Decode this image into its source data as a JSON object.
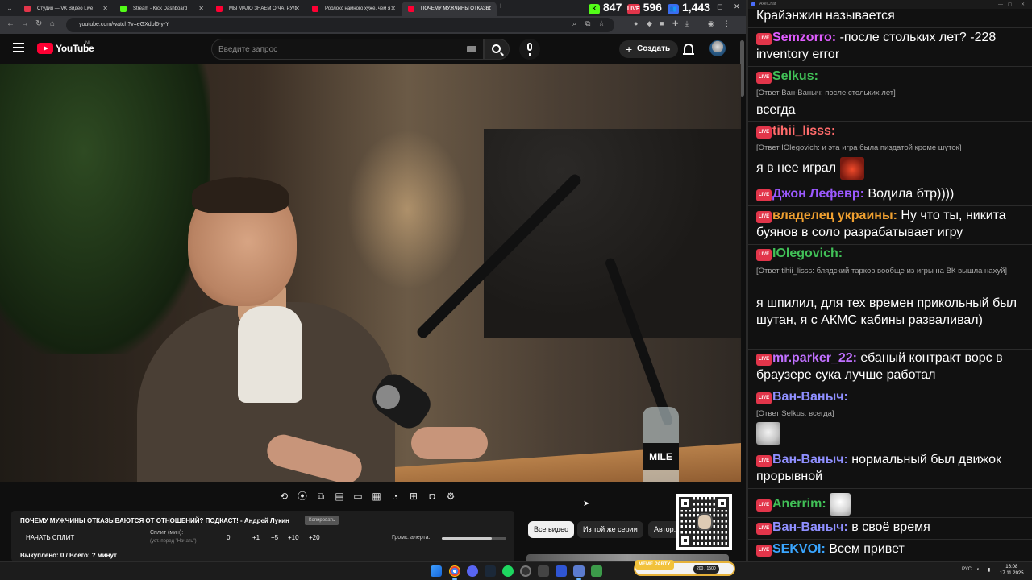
{
  "browser": {
    "tabs": [
      {
        "title": "Студия — VK Видео Live",
        "color": "#e2354a"
      },
      {
        "title": "Stream - Kick Dashboard",
        "color": "#53fc18"
      },
      {
        "title": "МЫ МАЛО ЗНАЕМ О ЧАТРУЛ",
        "color": "#ff0033"
      },
      {
        "title": "Роблокс намного хуже, чем я",
        "color": "#ff0033"
      },
      {
        "title": "ПОЧЕМУ МУЖЧИНЫ ОТКАЗЫ",
        "color": "#ff0033"
      }
    ],
    "url": "youtube.com/watch?v=eGXdpl6-y-Y",
    "counters": {
      "kick": "847",
      "vk": "596",
      "viewers": "1,443"
    },
    "counter_vk_icon": "LIVE"
  },
  "youtube": {
    "logo_text": "YouTube",
    "region": "NL",
    "search_placeholder": "Введите запрос",
    "create_label": "Создать"
  },
  "video": {
    "bottle_text": "MILE"
  },
  "overlay": {
    "title": "ПОЧЕМУ МУЖЧИНЫ ОТКАЗЫВАЮТСЯ ОТ ОТНОШЕНИЙ? ПОДКАСТ! - Андрей Лукин",
    "copy_label": "Копировать",
    "start_split": "НАЧАТЬ СПЛИТ",
    "split_label": "Сплит (мин):",
    "split_hint": "(уст. перед \"Начать\")",
    "split_buttons": [
      "0",
      "+1",
      "+5",
      "+10",
      "+20"
    ],
    "volume_label": "Громк. алерта:",
    "volume_level": 0.78,
    "redeemed": "Выкуплено: 0 / Всего: ? минут"
  },
  "chips": [
    "Все видео",
    "Из той же серии",
    "Автор:"
  ],
  "chat": {
    "window_title": "AxelChat",
    "live_badge": "LIVE",
    "messages": [
      {
        "type": "text",
        "text": "Крайэнжин называется"
      },
      {
        "nick": "Semzorro:",
        "color": "#e05cff",
        "text": " -после стольких лет? -228 inventory error"
      },
      {
        "nick": "Selkus:",
        "color": "#41c057",
        "reply": "[Ответ Ван-Ваныч: после стольких лет]",
        "text": "всегда"
      },
      {
        "nick": "tihii_lisss:",
        "color": "#ff6b6b",
        "reply": "[Ответ IOlegovich: и эта игра была пиздатой кроме шуток]",
        "text": "я в нее играл"
      },
      {
        "nick": "Джон Лефевр:",
        "color": "#9b59ff",
        "text": " Водила бтр))))"
      },
      {
        "nick": "владелец украины:",
        "color": "#f0a030",
        "text": " Ну что ты, никита буянов в соло разрабатывает игру"
      },
      {
        "nick": "IOlegovich:",
        "color": "#41c057",
        "reply": "[Ответ tihii_lisss: блядский тарков вообще из игры на ВК вышла нахуй]",
        "text": "я шпилил, для тех времен прикольный был шутан, я с АКМС кабины разваливал)"
      },
      {
        "nick": "mr.parker_22:",
        "color": "#c070ff",
        "text": " ебаный контракт ворс в браузере сука лучше работал"
      },
      {
        "nick": "Ван-Ваныч:",
        "color": "#8f8fff",
        "reply": "[Ответ Selkus: всегда]",
        "text": ""
      },
      {
        "nick": "Ван-Ваныч:",
        "color": "#8f8fff",
        "text": " нормальный был движок прорывной"
      },
      {
        "nick": "Anerrim:",
        "color": "#41c057",
        "text": ""
      },
      {
        "nick": "Ван-Ваныч:",
        "color": "#8f8fff",
        "text": " в своё время"
      },
      {
        "nick": "SEKVOI:",
        "color": "#3aa6ff",
        "text": " Всем привет"
      }
    ]
  },
  "taskbar": {
    "meme_party": "MEME PARTY",
    "meme_count": "200 / 1500",
    "lang": "РУС",
    "time": "16:08",
    "date": "17.11.2025"
  }
}
